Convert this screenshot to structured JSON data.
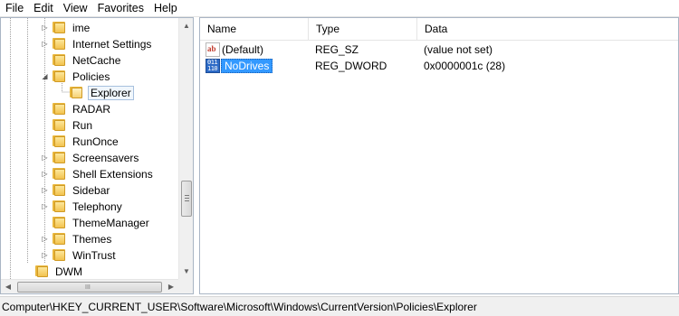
{
  "menu": [
    "File",
    "Edit",
    "View",
    "Favorites",
    "Help"
  ],
  "tree": {
    "items": [
      {
        "label": "ime",
        "expander": "collapsed"
      },
      {
        "label": "Internet Settings",
        "expander": "collapsed"
      },
      {
        "label": "NetCache",
        "expander": "none"
      },
      {
        "label": "Policies",
        "expander": "expanded"
      },
      {
        "label": "Explorer",
        "expander": "none",
        "selected": true
      },
      {
        "label": "RADAR",
        "expander": "none"
      },
      {
        "label": "Run",
        "expander": "none"
      },
      {
        "label": "RunOnce",
        "expander": "none"
      },
      {
        "label": "Screensavers",
        "expander": "collapsed"
      },
      {
        "label": "Shell Extensions",
        "expander": "collapsed"
      },
      {
        "label": "Sidebar",
        "expander": "collapsed"
      },
      {
        "label": "Telephony",
        "expander": "collapsed"
      },
      {
        "label": "ThemeManager",
        "expander": "none"
      },
      {
        "label": "Themes",
        "expander": "collapsed"
      },
      {
        "label": "WinTrust",
        "expander": "collapsed"
      },
      {
        "label": "DWM",
        "expander": "none"
      }
    ],
    "hscroll_grip": "III"
  },
  "list": {
    "columns": [
      "Name",
      "Type",
      "Data"
    ],
    "rows": [
      {
        "name": "(Default)",
        "type": "REG_SZ",
        "data": "(value not set)",
        "icon": "string-value-icon",
        "icon_text": "ab"
      },
      {
        "name": "NoDrives",
        "type": "REG_DWORD",
        "data": "0x0000001c (28)",
        "icon": "binary-value-icon",
        "icon_text": "011\n110",
        "selected": true
      }
    ]
  },
  "status": "Computer\\HKEY_CURRENT_USER\\Software\\Microsoft\\Windows\\CurrentVersion\\Policies\\Explorer",
  "colors": {
    "selection": "#3399ff",
    "folder": "#f3c34f"
  }
}
